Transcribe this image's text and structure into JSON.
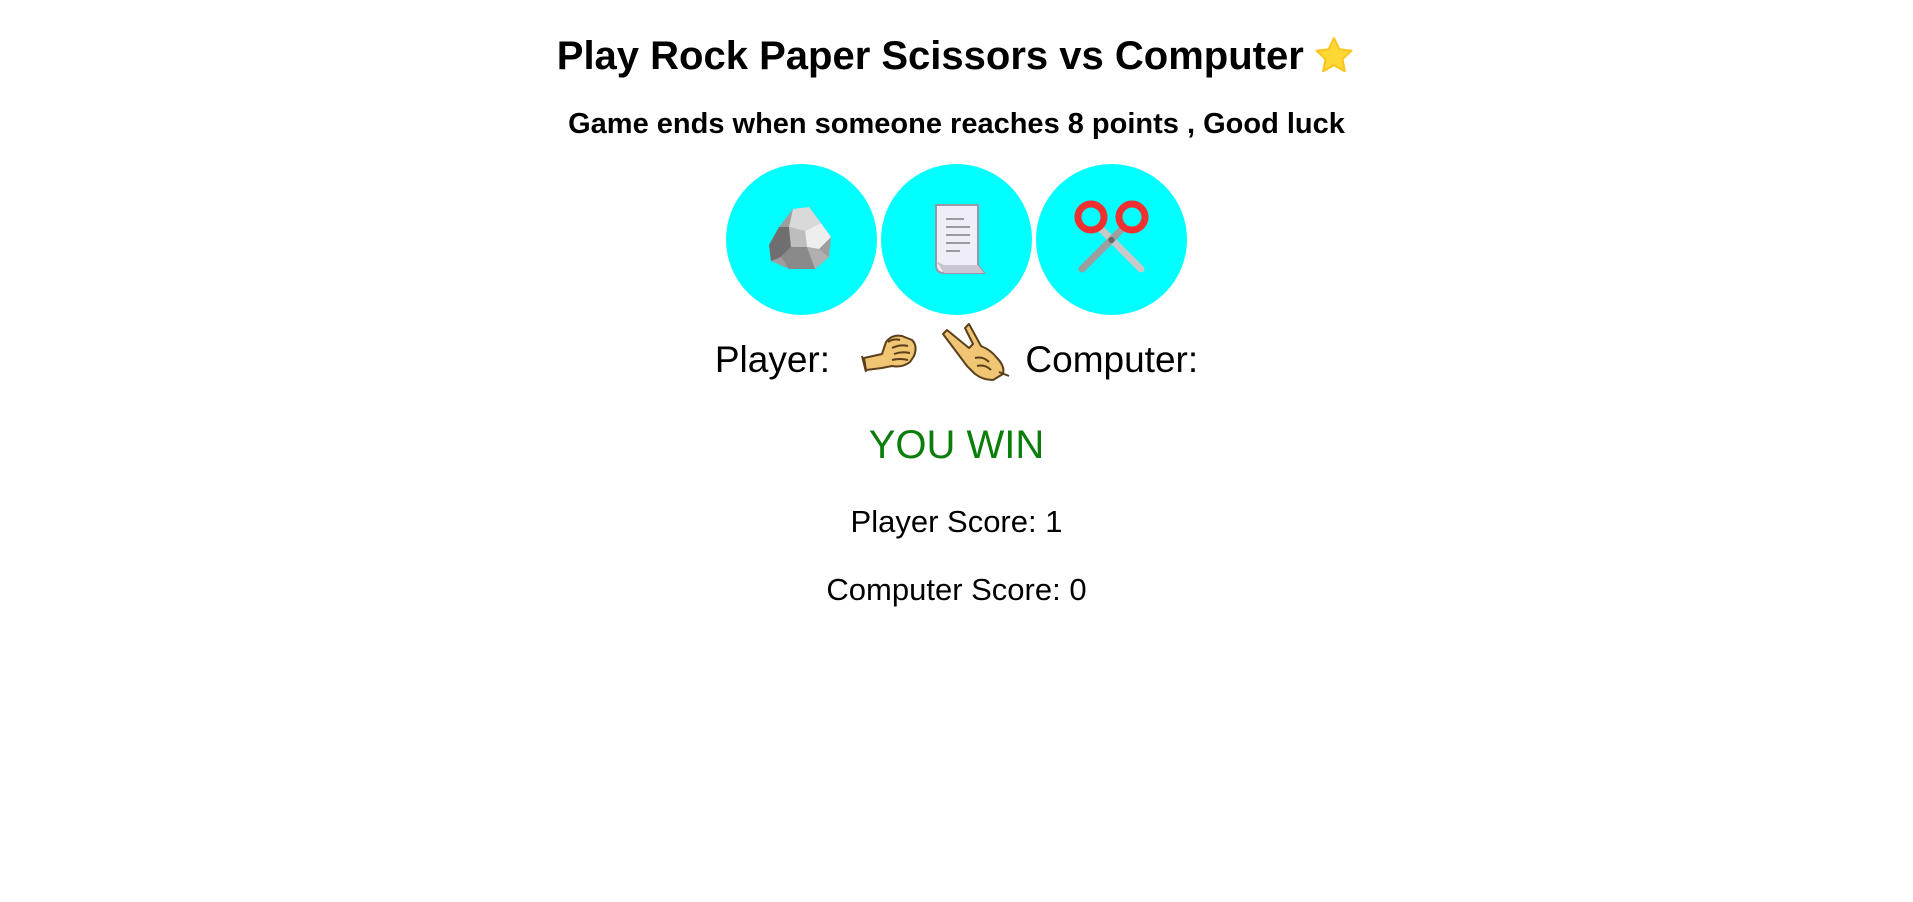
{
  "header": {
    "title": "Play Rock Paper Scissors vs Computer",
    "subtitle": "Game ends when someone reaches 8 points , Good luck",
    "title_icon": "star-icon"
  },
  "choices": [
    {
      "name": "rock",
      "icon": "rock-icon"
    },
    {
      "name": "paper",
      "icon": "paper-icon"
    },
    {
      "name": "scissors",
      "icon": "scissors-icon"
    }
  ],
  "round": {
    "player_label": "Player:",
    "computer_label": "Computer:",
    "player_hand": "fist-hand-icon",
    "computer_hand": "victory-hand-icon"
  },
  "result": {
    "status": "YOU WIN",
    "status_color": "#0a7d0a"
  },
  "scores": {
    "player": "Player Score: 1",
    "computer": "Computer Score: 0"
  },
  "colors": {
    "button_bg": "#00ffff",
    "star": "#fdd835"
  }
}
